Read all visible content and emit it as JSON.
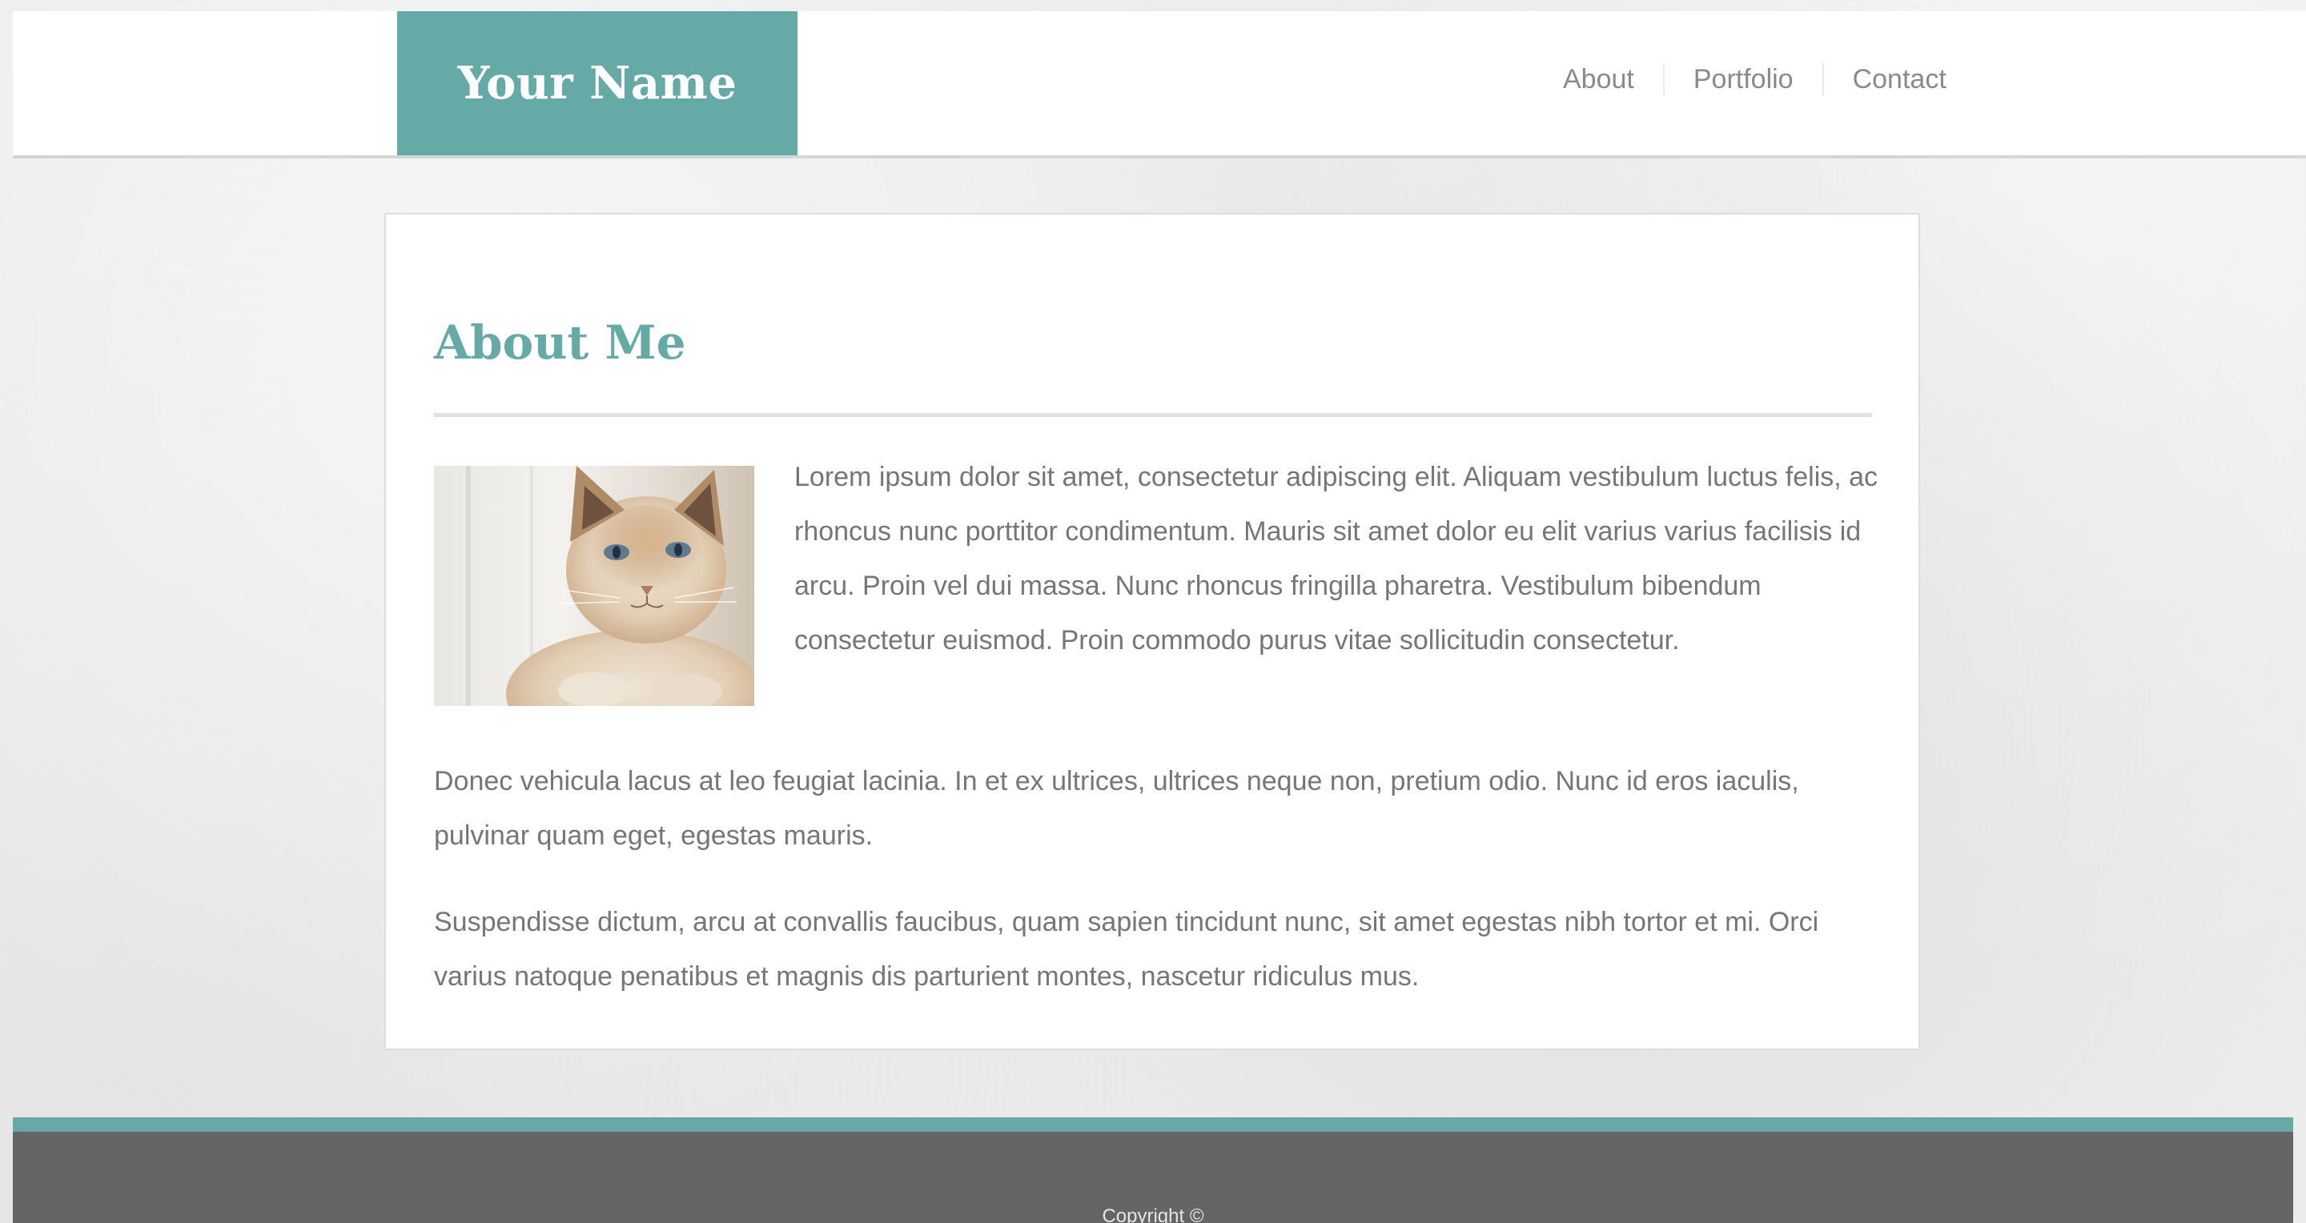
{
  "header": {
    "brand_name": "Your Name",
    "nav": [
      {
        "label": "About"
      },
      {
        "label": "Portfolio"
      },
      {
        "label": "Contact"
      }
    ]
  },
  "main": {
    "title": "About Me",
    "image_subject": "cat-photo",
    "paragraphs": [
      "Lorem ipsum dolor sit amet, consectetur adipiscing elit. Aliquam vestibulum luctus felis, ac rhoncus nunc porttitor condimentum. Mauris sit amet dolor eu elit varius varius facilisis id arcu. Proin vel dui massa. Nunc rhoncus fringilla pharetra. Vestibulum bibendum consectetur euismod. Proin commodo purus vitae sollicitudin consectetur.",
      "Donec vehicula lacus at leo feugiat lacinia. In et ex ultrices, ultrices neque non, pretium odio. Nunc id eros iaculis, pulvinar quam eget, egestas mauris.",
      "Suspendisse dictum, arcu at convallis faucibus, quam sapien tincidunt nunc, sit amet egestas nibh tortor et mi. Orci varius natoque penatibus et magnis dis parturient montes, nascetur ridiculus mus."
    ]
  },
  "footer": {
    "copyright": "Copyright ©"
  },
  "colors": {
    "accent": "#65aaa6",
    "text": "#767676",
    "footer_bg": "#656565",
    "background": "#ececec"
  }
}
